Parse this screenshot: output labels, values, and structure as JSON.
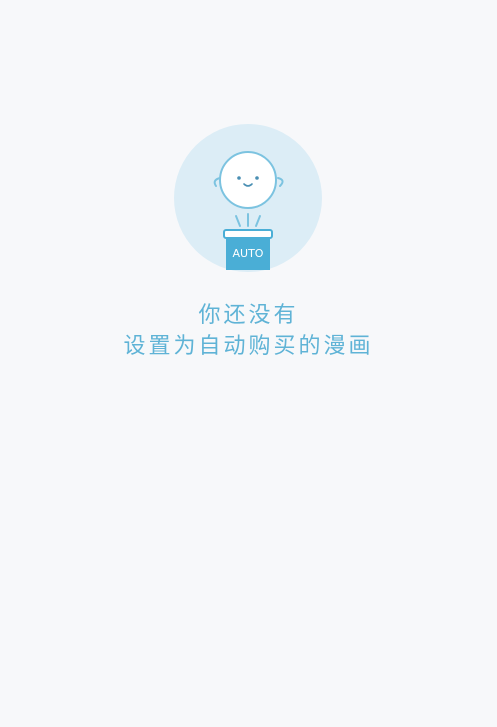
{
  "empty_state": {
    "illustration": {
      "icon": "auto-buy-mascot-icon",
      "badge_text": "AUTO",
      "circle_color": "#dcedf6",
      "accent_color": "#4aaed6"
    },
    "message_line1": "你还没有",
    "message_line2": "设置为自动购买的漫画"
  }
}
